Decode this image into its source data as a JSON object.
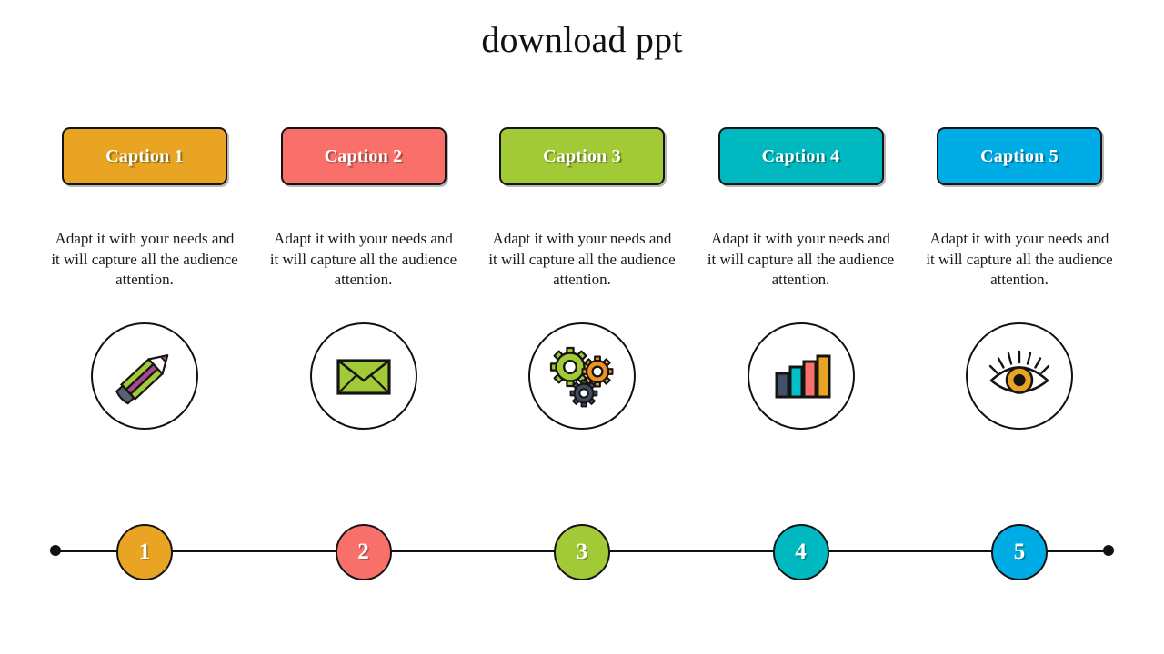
{
  "slide": {
    "title": "download ppt",
    "background": "#ffffff"
  },
  "palette": {
    "orange": "#e8a422",
    "salmon": "#f9706a",
    "green": "#a2c936",
    "teal": "#00b9c0",
    "blue": "#00ace5",
    "outline": "#141414",
    "text": "#1a1a1a"
  },
  "columns": [
    {
      "caption": "Caption 1",
      "body": "Adapt it with your needs and it will capture all the audience attention.",
      "icon": "pencil-icon",
      "number": "1",
      "color": "#e8a422"
    },
    {
      "caption": "Caption 2",
      "body": "Adapt it with your needs and it will capture all the audience attention.",
      "icon": "envelope-icon",
      "number": "2",
      "color": "#f9706a"
    },
    {
      "caption": "Caption 3",
      "body": "Adapt it with your needs and it will capture all the audience attention.",
      "icon": "gears-icon",
      "number": "3",
      "color": "#a2c936"
    },
    {
      "caption": "Caption 4",
      "body": "Adapt it with your needs and it will capture all the audience attention.",
      "icon": "bar-chart-icon",
      "number": "4",
      "color": "#00b9c0"
    },
    {
      "caption": "Caption 5",
      "body": "Adapt it with your needs and it will capture all the audience attention.",
      "icon": "eye-icon",
      "number": "5",
      "color": "#00ace5"
    }
  ],
  "timeline": {
    "endpoint_left": "dot",
    "endpoint_right": "dot"
  }
}
